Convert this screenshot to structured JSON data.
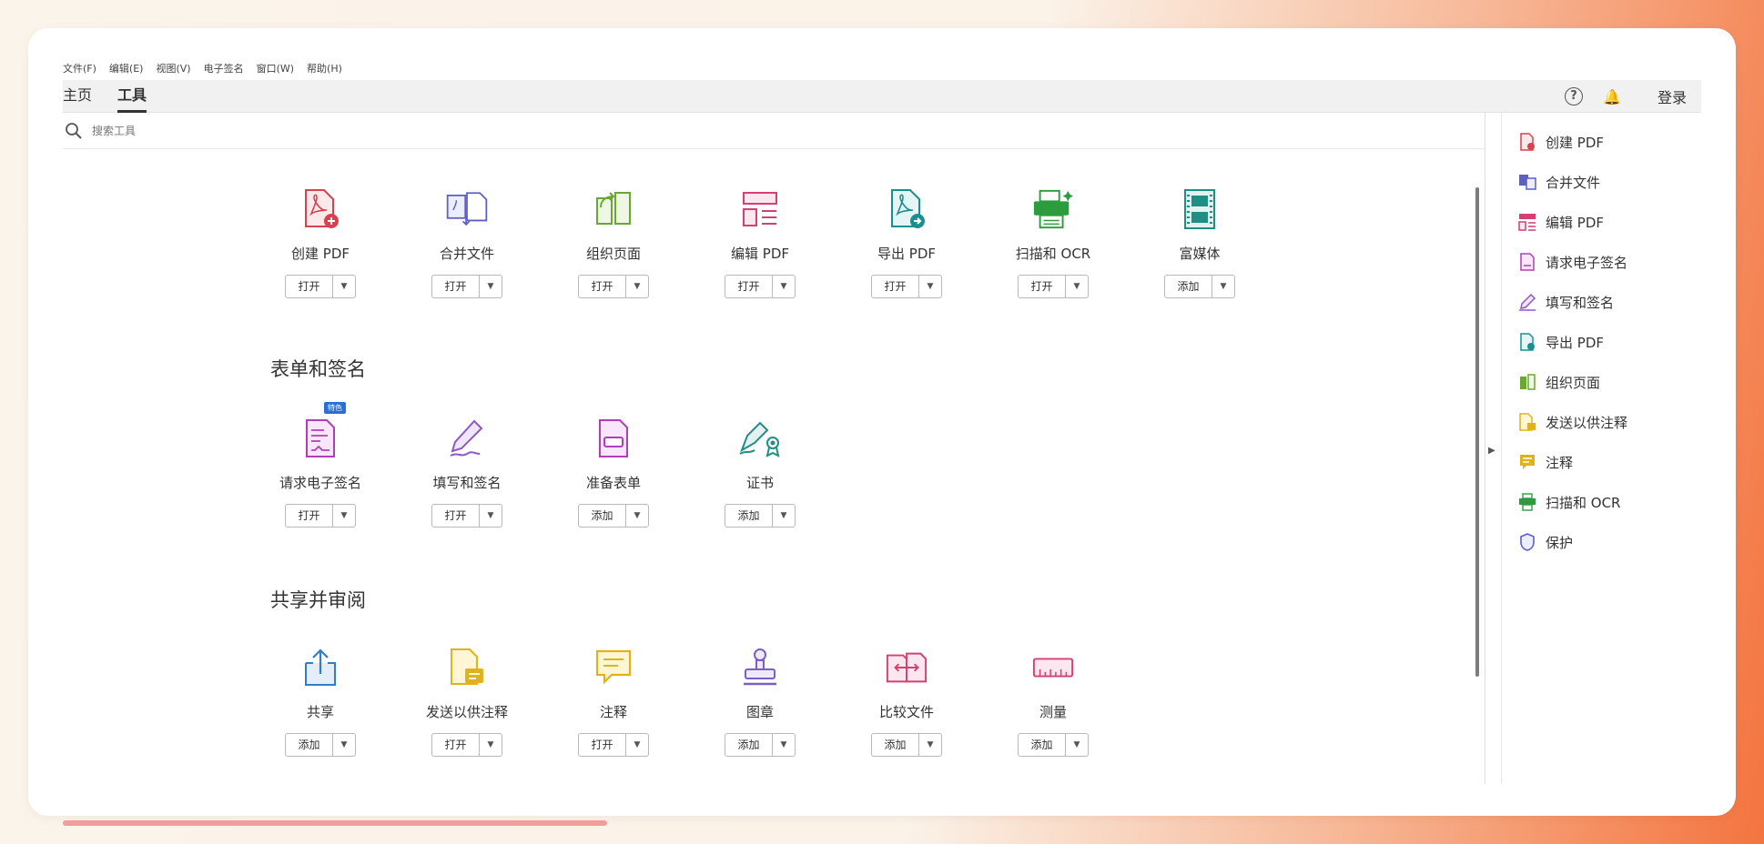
{
  "menu": [
    "文件(F)",
    "编辑(E)",
    "视图(V)",
    "电子签名",
    "窗口(W)",
    "帮助(H)"
  ],
  "tabs": {
    "home": "主页",
    "tools": "工具"
  },
  "header": {
    "help": "?",
    "login": "登录"
  },
  "search": {
    "placeholder": "搜索工具"
  },
  "sections": {
    "forms": "表单和签名",
    "share": "共享并审阅"
  },
  "tools_row1": [
    {
      "name": "创建 PDF",
      "action": "打开",
      "icon": "create-pdf-icon",
      "color": "#d9414f"
    },
    {
      "name": "合并文件",
      "action": "打开",
      "icon": "combine-files-icon",
      "color": "#5c5fc4"
    },
    {
      "name": "组织页面",
      "action": "打开",
      "icon": "organize-pages-icon",
      "color": "#6aa832"
    },
    {
      "name": "编辑 PDF",
      "action": "打开",
      "icon": "edit-pdf-icon",
      "color": "#d43f74"
    },
    {
      "name": "导出 PDF",
      "action": "打开",
      "icon": "export-pdf-icon",
      "color": "#1b8f8f"
    },
    {
      "name": "扫描和 OCR",
      "action": "打开",
      "icon": "scan-ocr-icon",
      "color": "#2b9d3f"
    },
    {
      "name": "富媒体",
      "action": "添加",
      "icon": "rich-media-icon",
      "color": "#1f8f84"
    }
  ],
  "tools_row2": [
    {
      "name": "请求电子签名",
      "action": "打开",
      "icon": "request-esign-icon",
      "color": "#b03fb7",
      "badge": "特色"
    },
    {
      "name": "填写和签名",
      "action": "打开",
      "icon": "fill-sign-icon",
      "color": "#8e59c2"
    },
    {
      "name": "准备表单",
      "action": "添加",
      "icon": "prepare-form-icon",
      "color": "#b03fb7"
    },
    {
      "name": "证书",
      "action": "添加",
      "icon": "certificate-icon",
      "color": "#1f8f84"
    }
  ],
  "tools_row3": [
    {
      "name": "共享",
      "action": "添加",
      "icon": "share-icon",
      "color": "#2e7ec9"
    },
    {
      "name": "发送以供注释",
      "action": "打开",
      "icon": "send-comment-icon",
      "color": "#e0b21b"
    },
    {
      "name": "注释",
      "action": "打开",
      "icon": "comment-icon",
      "color": "#e0b21b"
    },
    {
      "name": "图章",
      "action": "添加",
      "icon": "stamp-icon",
      "color": "#7a5fc4"
    },
    {
      "name": "比较文件",
      "action": "添加",
      "icon": "compare-files-icon",
      "color": "#d43f74"
    },
    {
      "name": "测量",
      "action": "添加",
      "icon": "measure-icon",
      "color": "#d43f74"
    }
  ],
  "right_panel": [
    {
      "name": "创建 PDF",
      "icon": "create-pdf-icon",
      "color": "#d9414f"
    },
    {
      "name": "合并文件",
      "icon": "combine-files-icon",
      "color": "#5c5fc4"
    },
    {
      "name": "编辑 PDF",
      "icon": "edit-pdf-icon",
      "color": "#d43f74"
    },
    {
      "name": "请求电子签名",
      "icon": "request-esign-icon",
      "color": "#b03fb7"
    },
    {
      "name": "填写和签名",
      "icon": "fill-sign-icon",
      "color": "#8e59c2"
    },
    {
      "name": "导出 PDF",
      "icon": "export-pdf-icon",
      "color": "#1b8f8f"
    },
    {
      "name": "组织页面",
      "icon": "organize-pages-icon",
      "color": "#6aa832"
    },
    {
      "name": "发送以供注释",
      "icon": "send-comment-icon",
      "color": "#e0b21b"
    },
    {
      "name": "注释",
      "icon": "comment-icon",
      "color": "#e0b21b"
    },
    {
      "name": "扫描和 OCR",
      "icon": "scan-ocr-icon",
      "color": "#2b9d3f"
    },
    {
      "name": "保护",
      "icon": "protect-icon",
      "color": "#5c5fc4"
    }
  ]
}
